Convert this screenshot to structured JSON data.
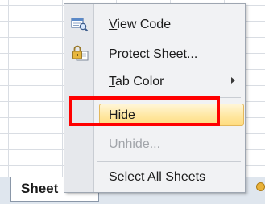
{
  "sheet_tab": {
    "label": "Sheet"
  },
  "context_menu": {
    "items": [
      {
        "label_underlined": "V",
        "label_rest": "iew Code",
        "icon": "view-code-icon",
        "enabled": true
      },
      {
        "label_underlined": "P",
        "label_rest": "rotect Sheet...",
        "icon": "protect-sheet-lock-icon",
        "enabled": true
      },
      {
        "label_underlined": "T",
        "label_rest": "ab Color",
        "icon": "",
        "enabled": true,
        "has_submenu": true
      },
      {
        "label_underlined": "H",
        "label_rest": "ide",
        "icon": "",
        "enabled": true,
        "highlighted": true
      },
      {
        "label_underlined": "U",
        "label_rest": "nhide...",
        "icon": "",
        "enabled": false
      },
      {
        "label_underlined": "S",
        "label_rest": "elect All Sheets",
        "icon": "",
        "enabled": true
      }
    ]
  },
  "colors": {
    "highlight_annotation": "#ff0000",
    "hover_fill": "#ffe9a6",
    "menu_background": "#f1f2f4"
  }
}
